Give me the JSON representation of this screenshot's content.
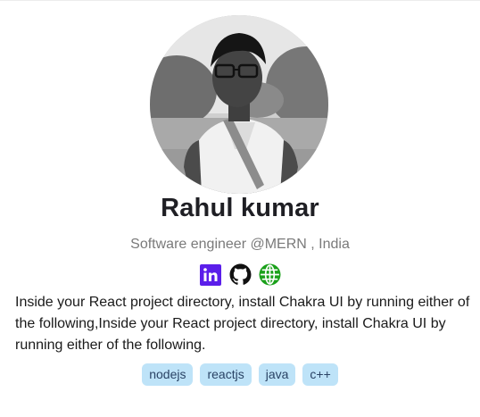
{
  "profile": {
    "name": "Rahul kumar",
    "subtitle": "Software engineer @MERN , India",
    "bio": "Inside your React project directory, install Chakra UI by running either of the following,Inside your React project directory, install Chakra UI by running either of the following."
  },
  "socials": [
    {
      "icon": "linkedin-icon",
      "color": "#5b1eea"
    },
    {
      "icon": "github-icon",
      "color": "#111111"
    },
    {
      "icon": "globe-icon",
      "color": "#1aa01a"
    }
  ],
  "tags": [
    "nodejs",
    "reactjs",
    "java",
    "c++"
  ],
  "colors": {
    "tag_bg": "#bee3f8",
    "tag_text": "#2a4365",
    "name": "#1f1f24",
    "subtitle": "#7a7a7a"
  }
}
